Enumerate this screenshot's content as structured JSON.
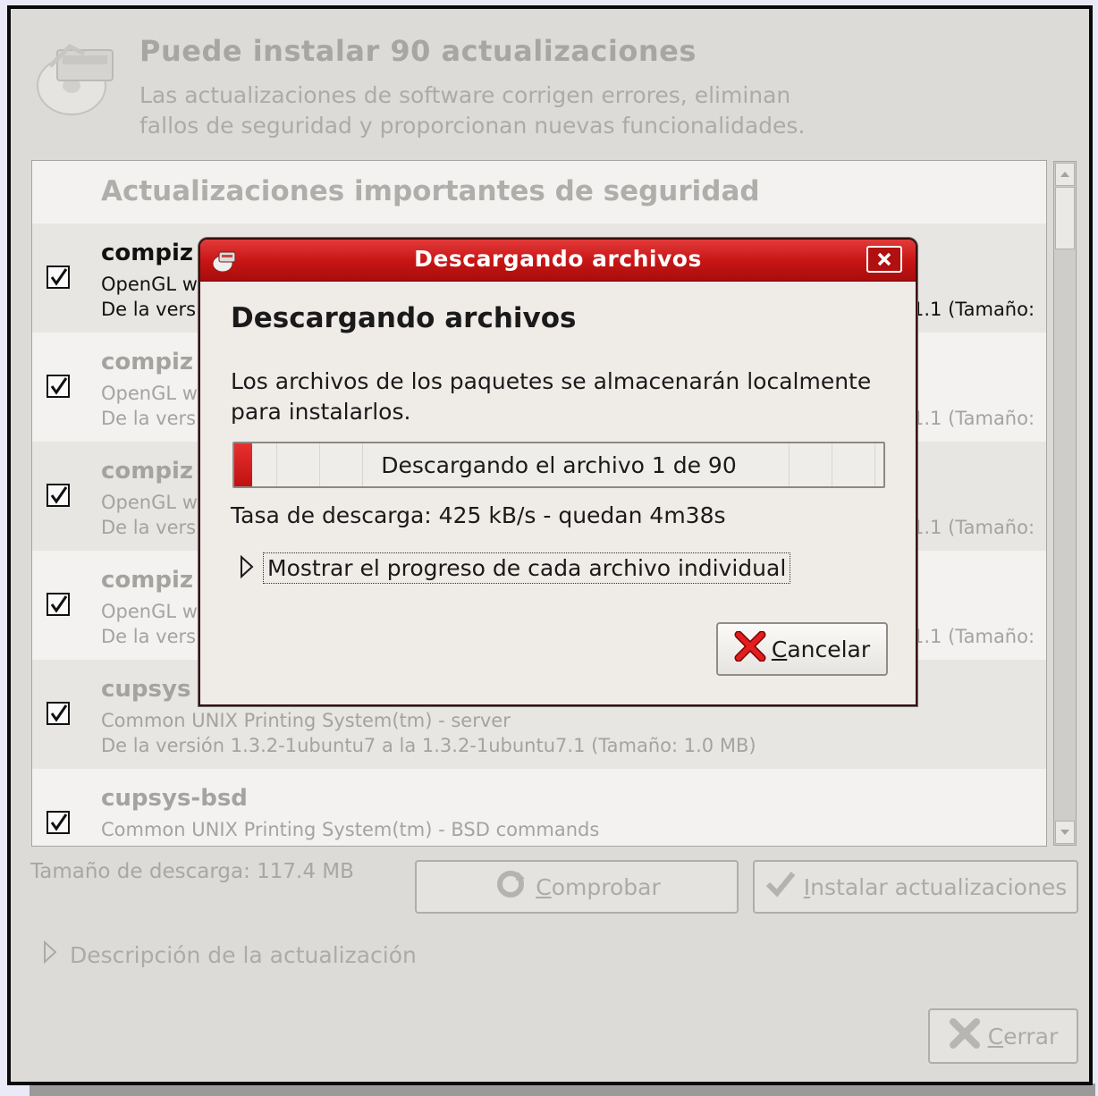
{
  "window": {
    "header_title": "Puede instalar 90 actualizaciones",
    "header_desc_line1": "Las actualizaciones de software corrigen errores, eliminan",
    "header_desc_line2": "fallos de seguridad y proporcionan nuevas funcionalidades."
  },
  "list": {
    "section_title": "Actualizaciones importantes de seguridad",
    "items": [
      {
        "name": "compiz",
        "desc": "OpenGL w",
        "ver": "De la vers",
        "ver_tail": "1.1 (Tamaño:",
        "checked": true
      },
      {
        "name": "compiz",
        "desc": "OpenGL w",
        "ver": "De la vers",
        "ver_tail": "1.1 (Tamaño:",
        "checked": true
      },
      {
        "name": "compiz",
        "desc": "OpenGL w",
        "ver": "De la vers",
        "ver_tail": "1.1 (Tamaño:",
        "checked": true
      },
      {
        "name": "compiz",
        "desc": "OpenGL w",
        "ver": "De la vers",
        "ver_tail": "1.1 (Tamaño:",
        "checked": true
      },
      {
        "name": "cupsys",
        "desc": "Common UNIX Printing System(tm) - server",
        "ver": "De la versión 1.3.2-1ubuntu7 a la 1.3.2-1ubuntu7.1 (Tamaño: 1.0 MB)",
        "checked": true
      },
      {
        "name": "cupsys-bsd",
        "desc": "Common UNIX Printing System(tm) - BSD commands",
        "checked": true
      }
    ]
  },
  "footer": {
    "download_size": "Tamaño de descarga: 117.4 MB",
    "check_label_first": "C",
    "check_label_rest": "omprobar",
    "install_label_first": "I",
    "install_label_rest": "nstalar actualizaciones",
    "description_expander": "Descripción de la actualización",
    "close_label_first": "C",
    "close_label_rest": "errar"
  },
  "dialog": {
    "title": "Descargando archivos",
    "heading": "Descargando archivos",
    "text": "Los archivos de los paquetes se almacenarán localmente para instalarlos.",
    "progress_text": "Descargando el archivo 1 de 90",
    "progress_fraction": 0.028,
    "rate_text": "Tasa de descarga: 425 kB/s - quedan 4m38s",
    "expander_label": "Mostrar el progreso de cada archivo individual",
    "cancel_label_first": "C",
    "cancel_label_rest": "ancelar"
  },
  "colors": {
    "titlebar": "#c61414",
    "progress": "#e02020",
    "background": "#dddbd8"
  },
  "icons": [
    "updates-icon",
    "checkbox-checked-icon",
    "refresh-icon",
    "check-icon",
    "triangle-right-icon",
    "close-x-icon",
    "dialog-app-icon",
    "titlebar-close-icon"
  ]
}
